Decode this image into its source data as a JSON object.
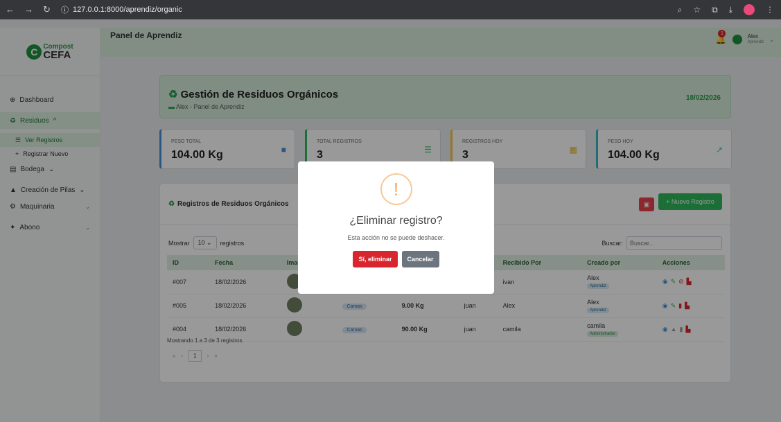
{
  "browser": {
    "url": "127.0.0.1:8000/aprendiz/organic"
  },
  "logo": {
    "line1": "Compost",
    "line2": "CEFA"
  },
  "sidebar": {
    "items": [
      {
        "label": "Dashboard"
      },
      {
        "label": "Residuos"
      },
      {
        "label": "Ver Registros"
      },
      {
        "label": "Registrar Nuevo"
      },
      {
        "label": "Bodega"
      },
      {
        "label": "Creación de Pilas"
      },
      {
        "label": "Maquinaria"
      },
      {
        "label": "Abono"
      }
    ]
  },
  "topbar": {
    "title": "Panel de Aprendiz",
    "notif_count": "1",
    "user_name": "Alex",
    "user_role": "Aprendiz"
  },
  "header": {
    "title": "Gestión de Residuos Orgánicos",
    "subtitle": "Alex - Panel de Aprendiz",
    "date": "18/02/2026"
  },
  "stats": [
    {
      "label": "PESO TOTAL",
      "value": "104.00 Kg"
    },
    {
      "label": "TOTAL REGISTROS",
      "value": "3"
    },
    {
      "label": "REGISTROS HOY",
      "value": "3"
    },
    {
      "label": "PESO HOY",
      "value": "104.00 Kg"
    }
  ],
  "card": {
    "title": "Registros de Residuos Orgánicos",
    "new_button": "+ Nuevo Registro"
  },
  "controls": {
    "show": "Mostrar",
    "per_page": "10",
    "records": "registros",
    "search_label": "Buscar:",
    "search_placeholder": "Buscar..."
  },
  "table": {
    "headers": [
      "ID",
      "Fecha",
      "Imagen",
      "",
      "",
      "",
      "Recibido Por",
      "Creado por",
      "Acciones"
    ],
    "rows": [
      {
        "id": "#007",
        "fecha": "18/02/2026",
        "tipo": "",
        "peso": "",
        "entregado": "",
        "recibido": "ivan",
        "creado": "Alex",
        "rol": "Aprendiz"
      },
      {
        "id": "#005",
        "fecha": "18/02/2026",
        "tipo": "Camas",
        "peso": "9.00 Kg",
        "entregado": "juan",
        "recibido": "Alex",
        "creado": "Alex",
        "rol": "Aprendiz"
      },
      {
        "id": "#004",
        "fecha": "18/02/2026",
        "tipo": "Camas",
        "peso": "90.00 Kg",
        "entregado": "juan",
        "recibido": "camila",
        "creado": "camila",
        "rol": "Administrador"
      }
    ]
  },
  "footer": {
    "info": "Mostrando 1 a 3 de 3 registros",
    "page": "1"
  },
  "modal": {
    "title": "¿Eliminar registro?",
    "text": "Esta acción no se puede deshacer.",
    "confirm": "Sí, eliminar",
    "cancel": "Cancelar"
  }
}
